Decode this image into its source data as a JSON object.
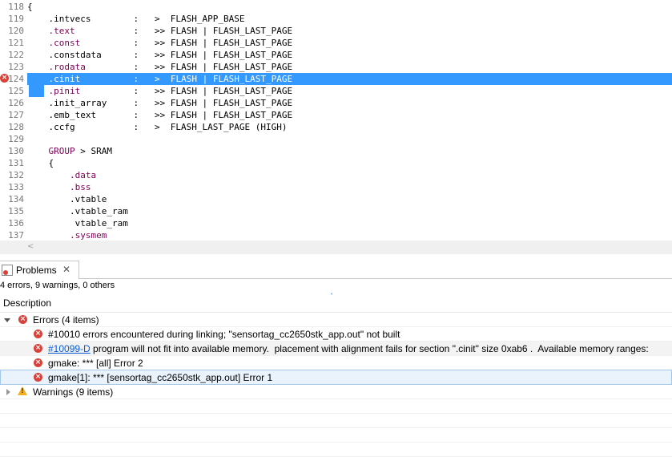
{
  "editor": {
    "lines": [
      {
        "num": "118",
        "parts": [
          {
            "t": "{",
            "kw": false
          }
        ]
      },
      {
        "num": "119",
        "parts": [
          {
            "t": "    .intvecs        :   >  FLASH_APP_BASE",
            "kw": false
          }
        ]
      },
      {
        "num": "120",
        "parts": [
          {
            "t": "    ",
            "kw": false
          },
          {
            "t": ".text",
            "kw": true
          },
          {
            "t": "           :   >> FLASH | FLASH_LAST_PAGE",
            "kw": false
          }
        ]
      },
      {
        "num": "121",
        "parts": [
          {
            "t": "    ",
            "kw": false
          },
          {
            "t": ".const",
            "kw": true
          },
          {
            "t": "          :   >> FLASH | FLASH_LAST_PAGE",
            "kw": false
          }
        ]
      },
      {
        "num": "122",
        "parts": [
          {
            "t": "    .constdata      :   >> FLASH | FLASH_LAST_PAGE",
            "kw": false
          }
        ]
      },
      {
        "num": "123",
        "parts": [
          {
            "t": "    ",
            "kw": false
          },
          {
            "t": ".rodata",
            "kw": true
          },
          {
            "t": "         :   >> FLASH | FLASH_LAST_PAGE",
            "kw": false
          }
        ]
      },
      {
        "num": "124",
        "parts": [
          {
            "t": "    ",
            "kw": false
          },
          {
            "t": ".cinit",
            "kw": true
          },
          {
            "t": "          :   >  FLASH | FLASH_LAST_PAGE",
            "kw": false
          }
        ],
        "selected": true,
        "error": true
      },
      {
        "num": "125",
        "parts": [
          {
            "t": "    ",
            "kw": false
          },
          {
            "t": ".pinit",
            "kw": true
          },
          {
            "t": "          :   >> FLASH | FLASH_LAST_PAGE",
            "kw": false
          }
        ],
        "marker": true
      },
      {
        "num": "126",
        "parts": [
          {
            "t": "    .init_array     :   >> FLASH | FLASH_LAST_PAGE",
            "kw": false
          }
        ]
      },
      {
        "num": "127",
        "parts": [
          {
            "t": "    .emb_text       :   >> FLASH | FLASH_LAST_PAGE",
            "kw": false
          }
        ]
      },
      {
        "num": "128",
        "parts": [
          {
            "t": "    .ccfg           :   >  FLASH_LAST_PAGE (HIGH)",
            "kw": false
          }
        ]
      },
      {
        "num": "129",
        "parts": [
          {
            "t": "",
            "kw": false
          }
        ]
      },
      {
        "num": "130",
        "parts": [
          {
            "t": "    ",
            "kw": false
          },
          {
            "t": "GROUP",
            "kw": true
          },
          {
            "t": " > SRAM",
            "kw": false
          }
        ]
      },
      {
        "num": "131",
        "parts": [
          {
            "t": "    {",
            "kw": false
          }
        ]
      },
      {
        "num": "132",
        "parts": [
          {
            "t": "        ",
            "kw": false
          },
          {
            "t": ".data",
            "kw": true
          }
        ]
      },
      {
        "num": "133",
        "parts": [
          {
            "t": "        ",
            "kw": false
          },
          {
            "t": ".bss",
            "kw": true
          }
        ]
      },
      {
        "num": "134",
        "parts": [
          {
            "t": "        .vtable",
            "kw": false
          }
        ]
      },
      {
        "num": "135",
        "parts": [
          {
            "t": "        .vtable_ram",
            "kw": false
          }
        ]
      },
      {
        "num": "136",
        "parts": [
          {
            "t": "         vtable_ram",
            "kw": false
          }
        ]
      },
      {
        "num": "137",
        "parts": [
          {
            "t": "        ",
            "kw": false
          },
          {
            "t": ".sysmem",
            "kw": true
          }
        ]
      }
    ],
    "scroll_left_arrow": "<"
  },
  "problems": {
    "tab_label": "Problems",
    "tab_close": "✕",
    "summary": "4 errors, 9 warnings, 0 others",
    "column_header": "Description",
    "sort_indicator": "˄",
    "errors_group": "Errors (4 items)",
    "errors": [
      {
        "code": "",
        "text": "#10010 errors encountered during linking; \"sensortag_cc2650stk_app.out\" not built"
      },
      {
        "code": "#10099-D",
        "text": " program will not fit into available memory.  placement with alignment fails for section \".cinit\" size 0xab6 .  Available memory ranges:"
      },
      {
        "code": "",
        "text": "gmake: *** [all] Error 2"
      },
      {
        "code": "",
        "text": "gmake[1]: *** [sensortag_cc2650stk_app.out] Error 1"
      }
    ],
    "warnings_group": "Warnings (9 items)",
    "icons": {
      "error": "error-icon",
      "warning": "warning-icon",
      "view": "problems-view-icon"
    }
  },
  "colors": {
    "selection": "#3399ff",
    "keyword": "#7f0055",
    "error": "#d9423a",
    "link": "#0b5bd3"
  }
}
